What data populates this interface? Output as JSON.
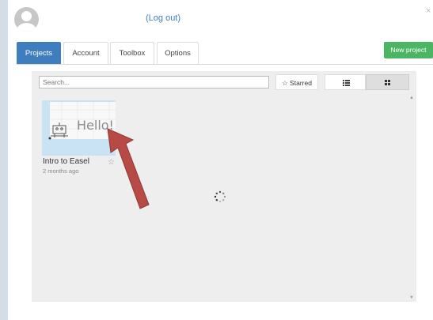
{
  "header": {
    "logout_label": "(Log out)",
    "close_glyph": "×"
  },
  "tabs": [
    {
      "label": "Projects",
      "active": true
    },
    {
      "label": "Account",
      "active": false
    },
    {
      "label": "Toolbox",
      "active": false
    },
    {
      "label": "Options",
      "active": false
    }
  ],
  "actions": {
    "new_project_label": "New project"
  },
  "toolbar": {
    "search_placeholder": "Search...",
    "starred_label": "☆ Starred",
    "list_view_icon": "list-view-icon",
    "grid_view_icon": "grid-view-icon",
    "active_view": "grid"
  },
  "projects": [
    {
      "title": "Intro to Easel",
      "updated": "2 months ago",
      "thumbnail_text": "Hello!",
      "starred": false
    }
  ],
  "status": {
    "loading": true
  },
  "colors": {
    "primary_tab": "#3e7ebf",
    "new_project": "#4bb563",
    "arrow": "#b84a45"
  }
}
